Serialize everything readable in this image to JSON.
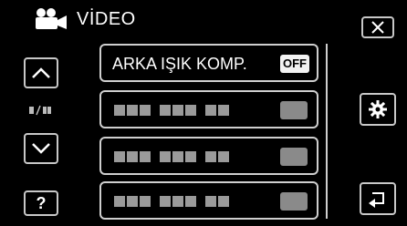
{
  "header": {
    "title": "VİDEO",
    "mode_icon": "video-camera-icon"
  },
  "nav": {
    "close_icon": "close-icon",
    "up_icon": "chevron-up-icon",
    "down_icon": "chevron-down-icon",
    "help_label": "?",
    "settings_icon": "gear-icon",
    "back_icon": "return-icon",
    "page_indicator_icon": "page-indicator-icon"
  },
  "menu": {
    "items": [
      {
        "label": "ARKA IŞIK KOMP.",
        "value": "OFF"
      },
      {
        "label": "",
        "value": ""
      },
      {
        "label": "",
        "value": ""
      },
      {
        "label": "",
        "value": ""
      }
    ]
  }
}
